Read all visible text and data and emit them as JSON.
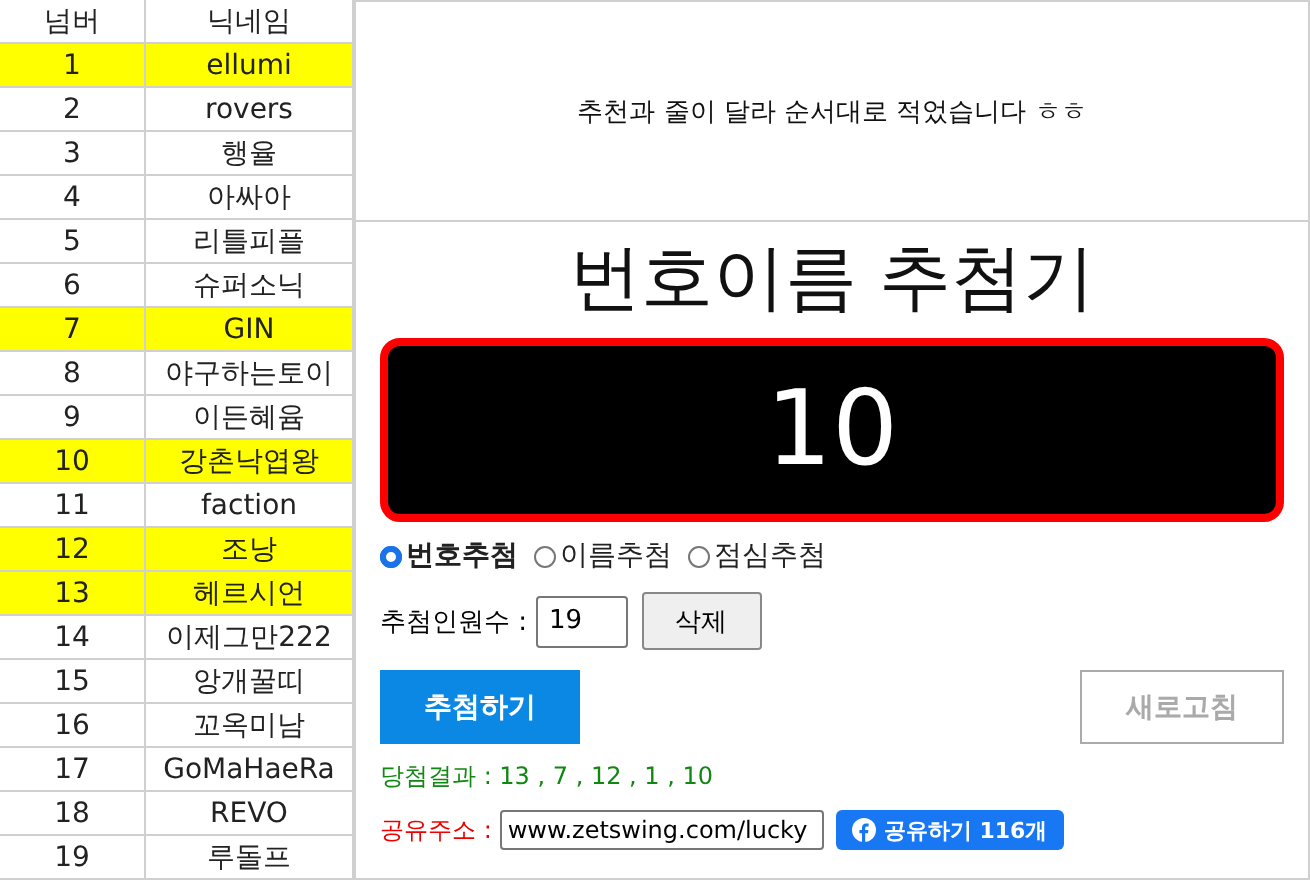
{
  "table": {
    "columns": [
      "넘버",
      "닉네임"
    ],
    "rows": [
      {
        "number": "1",
        "nickname": "ellumi",
        "highlighted": true
      },
      {
        "number": "2",
        "nickname": "rovers",
        "highlighted": false
      },
      {
        "number": "3",
        "nickname": "행율",
        "highlighted": false
      },
      {
        "number": "4",
        "nickname": "아싸아",
        "highlighted": false
      },
      {
        "number": "5",
        "nickname": "리틀피플",
        "highlighted": false
      },
      {
        "number": "6",
        "nickname": "슈퍼소닉",
        "highlighted": false
      },
      {
        "number": "7",
        "nickname": "GIN",
        "highlighted": true
      },
      {
        "number": "8",
        "nickname": "야구하는토이",
        "highlighted": false
      },
      {
        "number": "9",
        "nickname": "이든혜윰",
        "highlighted": false
      },
      {
        "number": "10",
        "nickname": "강촌낙엽왕",
        "highlighted": true
      },
      {
        "number": "11",
        "nickname": "faction",
        "highlighted": false
      },
      {
        "number": "12",
        "nickname": "조낭",
        "highlighted": true
      },
      {
        "number": "13",
        "nickname": "헤르시언",
        "highlighted": true
      },
      {
        "number": "14",
        "nickname": "이제그만222",
        "highlighted": false
      },
      {
        "number": "15",
        "nickname": "앙개꿀띠",
        "highlighted": false
      },
      {
        "number": "16",
        "nickname": "꼬옥미남",
        "highlighted": false
      },
      {
        "number": "17",
        "nickname": "GoMaHaeRa",
        "highlighted": false
      },
      {
        "number": "18",
        "nickname": "REVO",
        "highlighted": false
      },
      {
        "number": "19",
        "nickname": "루돌프",
        "highlighted": false
      }
    ]
  },
  "notice": "추천과 줄이 달라 순서대로 적었습니다 ㅎㅎ",
  "drawer": {
    "title": "번호이름 추첨기",
    "display": "10",
    "modes": [
      {
        "label": "번호추첨",
        "selected": true
      },
      {
        "label": "이름추첨",
        "selected": false
      },
      {
        "label": "점심추첨",
        "selected": false
      }
    ],
    "count_label": "추첨인원수 :",
    "count_value": "19",
    "delete_button": "삭제",
    "draw_button": {
      "label": "추첨하기",
      "disabled": false
    },
    "refresh_button": {
      "label": "새로고침",
      "disabled": true
    },
    "result_label": "당첨결과 :",
    "result": "13 , 7 , 12 , 1 , 10",
    "share_label": "공유주소 :",
    "share_url": "www.zetswing.com/lucky",
    "share_button": "공유하기 116개"
  }
}
